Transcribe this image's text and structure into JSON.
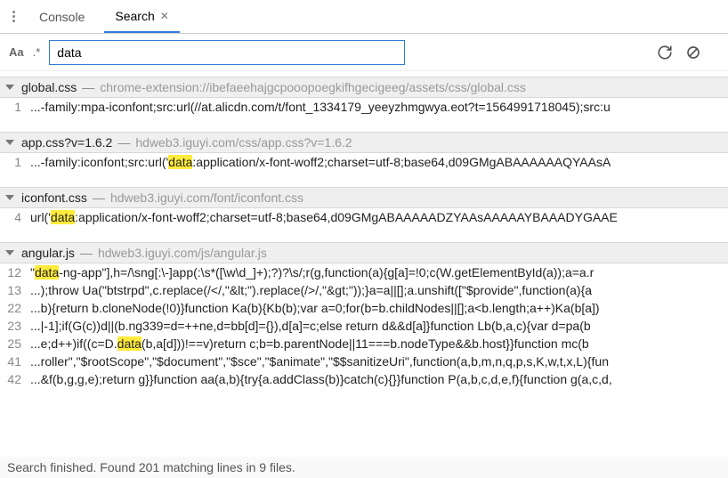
{
  "tabs": {
    "console": "Console",
    "search": "Search"
  },
  "search": {
    "aa": "Aa",
    "regex": ".*",
    "value": "data"
  },
  "groups": [
    {
      "file": "global.css",
      "path": "chrome-extension://ibefaeehajgcpooopoegkifhgecigeeg/assets/css/global.css",
      "lines": [
        {
          "n": "1",
          "pre": "...-family:mpa-iconfont;src:url(//at.alicdn.com/t/font_1334179_yeeyzhmgwya.eot?t=1564991718045);src:u",
          "hl": "",
          "post": ""
        }
      ]
    },
    {
      "file": "app.css?v=1.6.2",
      "path": "hdweb3.iguyi.com/css/app.css?v=1.6.2",
      "lines": [
        {
          "n": "1",
          "pre": "...-family:iconfont;src:url('",
          "hl": "data",
          "post": ":application/x-font-woff2;charset=utf-8;base64,d09GMgABAAAAAAQYAAsA"
        }
      ]
    },
    {
      "file": "iconfont.css",
      "path": "hdweb3.iguyi.com/font/iconfont.css",
      "lines": [
        {
          "n": "4",
          "pre": "url('",
          "hl": "data",
          "post": ":application/x-font-woff2;charset=utf-8;base64,d09GMgABAAAAADZYAAsAAAAAYBAAADYGAAE"
        }
      ]
    },
    {
      "file": "angular.js",
      "path": "hdweb3.iguyi.com/js/angular.js",
      "lines": [
        {
          "n": "12",
          "pre": "\"",
          "hl": "data",
          "post": "-ng-app\"],h=/\\sng[:\\-]app(:\\s*([\\w\\d_]+);?)?\\s/;r(g,function(a){g[a]=!0;c(W.getElementById(a));a=a.r"
        },
        {
          "n": "13",
          "pre": "...);throw Ua(\"btstrpd\",c.replace(/</,\"&lt;\").replace(/>/,\"&gt;\"));}a=a||[];a.unshift([\"$provide\",function(a){a",
          "hl": "",
          "post": ""
        },
        {
          "n": "22",
          "pre": "...b){return b.cloneNode(!0)}function Ka(b){Kb(b);var a=0;for(b=b.childNodes||[];a<b.length;a++)Ka(b[a])",
          "hl": "",
          "post": ""
        },
        {
          "n": "23",
          "pre": "...|-1];if(G(c))d||(b.ng339=d=++ne,d=bb[d]={}),d[a]=c;else return d&&d[a]}function Lb(b,a,c){var d=pa(b",
          "hl": "",
          "post": ""
        },
        {
          "n": "25",
          "pre": "...e;d++)if((c=D.",
          "hl": "data",
          "post": "(b,a[d]))!==v)return c;b=b.parentNode||11===b.nodeType&&b.host}}function mc(b"
        },
        {
          "n": "41",
          "pre": "...roller\",\"$rootScope\",\"$document\",\"$sce\",\"$animate\",\"$$sanitizeUri\",function(a,b,m,n,q,p,s,K,w,t,x,L){fun",
          "hl": "",
          "post": ""
        },
        {
          "n": "42",
          "pre": "...&f(b,g,g,e);return g}}function aa(a,b){try{a.addClass(b)}catch(c){}}function P(a,b,c,d,e,f){function g(a,c,d,",
          "hl": "",
          "post": ""
        }
      ]
    }
  ],
  "status": "Search finished. Found 201 matching lines in 9 files."
}
